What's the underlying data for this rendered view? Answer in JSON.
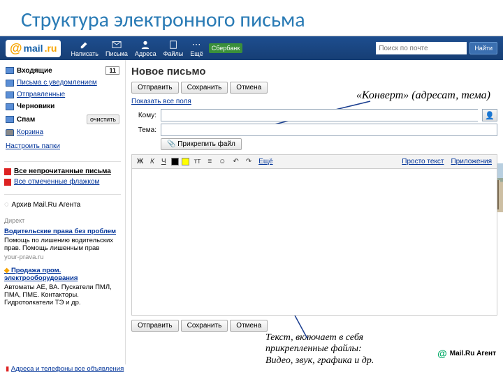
{
  "slide_title": "Структура электронного письма",
  "logo": {
    "brand": "mail",
    "tld": ".ru"
  },
  "nav": {
    "compose": "Написать",
    "mail": "Письма",
    "contacts": "Адреса",
    "files": "Файлы",
    "more": "Ещё"
  },
  "promo": "Сбербанк",
  "search": {
    "placeholder": "Поиск по почте",
    "button": "Найти"
  },
  "folders": {
    "inbox": {
      "label": "Входящие",
      "count": "11"
    },
    "flagged": "Письма с уведомлением",
    "sent": "Отправленные",
    "drafts": "Черновики",
    "spam": {
      "label": "Спам",
      "clear": "очистить"
    },
    "trash": "Корзина"
  },
  "manage_folders": "Настроить папки",
  "filters": {
    "unread": "Все непрочитанные письма",
    "marked": "Все отмеченные флажком"
  },
  "agent_archive": "Архив Mail.Ru Агента",
  "ads": {
    "header": "Директ",
    "ad1": {
      "title": "Водительские права без проблем",
      "text": "Помощь по лишению водительских прав. Помощь лишенным прав",
      "sub": "your-prava.ru"
    },
    "ad2": {
      "title": "Продажа пром. электрооборудования",
      "text": "Автоматы АЕ, ВА. Пускатели ПМЛ, ПМА, ПМЕ. Контакторы. Гидротолкатели ТЭ и др."
    }
  },
  "bottom_side": "Адреса и телефоны   все объявления",
  "compose": {
    "heading": "Новое письмо",
    "send": "Отправить",
    "save": "Сохранить",
    "cancel": "Отмена",
    "show_all": "Показать все поля",
    "to": "Кому:",
    "subject": "Тема:",
    "attach": "Прикрепить файл",
    "plain": "Просто текст",
    "apps": "Приложения",
    "more": "Ещё"
  },
  "mail_agent": "Mail.Ru Агент",
  "annotation1": "«Конверт» (адресат, тема)",
  "annotation2": "Текст, включает в себя \nприкрепленные файлы: \nВидео, звук, графика и др."
}
